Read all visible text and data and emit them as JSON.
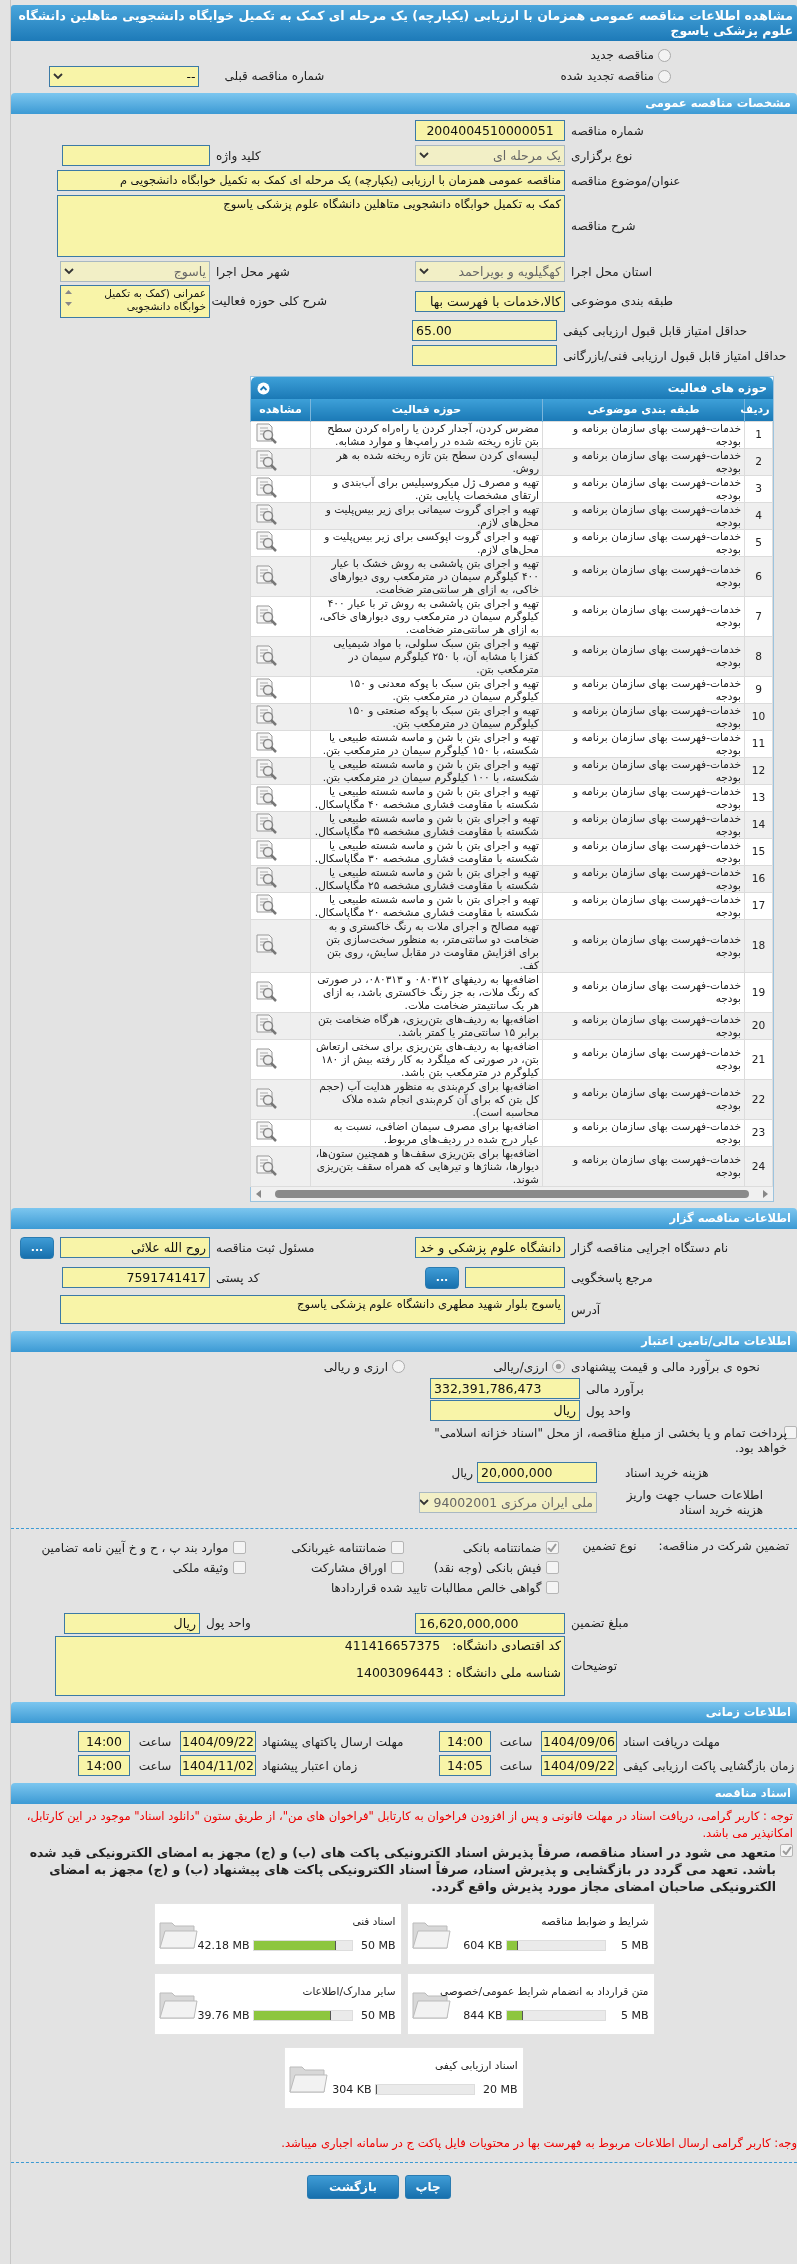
{
  "page_title": "مشاهده اطلاعات مناقصه عمومی همزمان با ارزیابی (یکپارچه) یک مرحله ای کمک به تکمیل خوابگاه دانشجویی متاهلین دانشگاه علوم پزشکی یاسوج",
  "tender_kind": [
    {
      "label": "مناقصه جدید",
      "selected": false
    },
    {
      "label": "مناقصه تجدید شده",
      "selected": false
    }
  ],
  "previous_tender": {
    "label": "شماره مناقصه قبلی",
    "value": "--"
  },
  "general": {
    "header": "مشخصات مناقصه عمومی",
    "rows": [
      [
        {
          "label": "شماره مناقصه",
          "kind": "code",
          "value": "2004004510000051"
        }
      ],
      [
        {
          "label": "نوع برگزاری",
          "kind": "select",
          "value": "یک مرحله ای"
        },
        {
          "label": "کلید واژه",
          "kind": "text"
        }
      ],
      [
        {
          "label": "عنوان/موضوع مناقصه",
          "kind": "wide",
          "value": "مناقصه عمومی همزمان با ارزیابی (یکپارچه) یک مرحله ای کمک به تکمیل خوابگاه دانشجویی م"
        }
      ],
      [
        {
          "label": "شرح مناقصه",
          "kind": "area",
          "value": "کمک به تکمیل خوابگاه دانشجویی متاهلین دانشگاه علوم پزشکی یاسوج"
        }
      ],
      [
        {
          "label": "استان محل اجرا",
          "kind": "select",
          "value": "کهگیلویه و بویراحمد"
        },
        {
          "label": "شهر محل اجرا",
          "kind": "select",
          "value": "یاسوج"
        }
      ],
      [
        {
          "label": "طبقه بندی موضوعی",
          "kind": "text",
          "value": "کالا،خدمات با فهرست بها"
        },
        {
          "label": "شرح کلی حوزه فعالیت",
          "kind": "list",
          "value": "عمرانی  (کمک به تکمیل خوابگاه دانشجویی"
        }
      ],
      [
        {
          "label": "حداقل امتیاز قابل قبول ارزیابی کیفی",
          "kind": "score",
          "value": "65.00"
        }
      ],
      [
        {
          "label": "حداقل امتیاز قابل قبول ارزیابی فنی/بازرگانی",
          "kind": "score"
        }
      ]
    ]
  },
  "activities": {
    "header": "حوزه های فعالیت",
    "columns": [
      "ردیف",
      "طبقه بندی موضوعی",
      "حوزه فعالیت",
      "مشاهده"
    ],
    "rows": [
      [
        "1",
        "خدمات-فهرست بهای سازمان برنامه و بودجه",
        "مضرس کردن، آجدار کردن یا راه‌راه کردن سطح بتن تازه ریخته شده در رامپ‌ها و موارد مشابه."
      ],
      [
        "2",
        "خدمات-فهرست بهای سازمان برنامه و بودجه",
        "لیسه‌ای کردن سطح بتن تازه ریخته شده به هر روش."
      ],
      [
        "3",
        "خدمات-فهرست بهای سازمان برنامه و بودجه",
        "تهیه و مصرف ژل میکروسیلیس برای آب‌بندی و ارتقای مشخصات پایایی بتن."
      ],
      [
        "4",
        "خدمات-فهرست بهای سازمان برنامه و بودجه",
        "تهیه و اجرای گروت سیمانی برای زیر بیس‌پلیت و محل‌های لازم."
      ],
      [
        "5",
        "خدمات-فهرست بهای سازمان برنامه و بودجه",
        "تهیه و اجرای گروت اپوکسی برای زیر بیس‌پلیت و محل‌های لازم."
      ],
      [
        "6",
        "خدمات-فهرست بهای سازمان برنامه و بودجه",
        "تهیه و اجرای بتن پاششی به روش خشک با عیار ۴۰۰ کیلوگرم سیمان در مترمکعب روی دیوارهای خاکی، به ازای هر سانتی‌متر ضخامت."
      ],
      [
        "7",
        "خدمات-فهرست بهای سازمان برنامه و بودجه",
        "تهیه و اجرای بتن پاششی به روش تر با عیار ۴۰۰ کیلوگرم سیمان در مترمکعب روی دیوارهای خاکی، به ازای هر سانتی‌متر ضخامت."
      ],
      [
        "8",
        "خدمات-فهرست بهای سازمان برنامه و بودجه",
        "تهیه و اجرای بتن سبک سلولی، با مواد شیمیایی کفزا یا مشابه آن، با ۲۵۰ کیلوگرم سیمان در مترمکعب بتن."
      ],
      [
        "9",
        "خدمات-فهرست بهای سازمان برنامه و بودجه",
        "تهیه و اجرای بتن سبک با پوکه معدنی و ۱۵۰ کیلوگرم سیمان در مترمکعب بتن."
      ],
      [
        "10",
        "خدمات-فهرست بهای سازمان برنامه و بودجه",
        "تهیه و اجرای بتن سبک با پوکه صنعتی و ۱۵۰ کیلوگرم سیمان در مترمکعب بتن."
      ],
      [
        "11",
        "خدمات-فهرست بهای سازمان برنامه و بودجه",
        "تهیه و اجرای بتن با شن و ماسه شسته طبیعی یا شکسته، با ۱۵۰ کیلوگرم سیمان در مترمکعب بتن."
      ],
      [
        "12",
        "خدمات-فهرست بهای سازمان برنامه و بودجه",
        "تهیه و اجرای بتن با شن و ماسه شسته طبیعی یا شکسته، با ۱۰۰ کیلوگرم سیمان در مترمکعب بتن."
      ],
      [
        "13",
        "خدمات-فهرست بهای سازمان برنامه و بودجه",
        "تهیه و اجرای بتن با شن و ماسه شسته طبیعی یا شکسته با مقاومت فشاری مشخصه ۴۰ مگاپاسکال."
      ],
      [
        "14",
        "خدمات-فهرست بهای سازمان برنامه و بودجه",
        "تهیه و اجرای بتن با شن و ماسه شسته طبیعی یا شکسته با مقاومت فشاری مشخصه ۳۵ مگاپاسکال."
      ],
      [
        "15",
        "خدمات-فهرست بهای سازمان برنامه و بودجه",
        "تهیه و اجرای بتن با شن و ماسه شسته طبیعی یا شکسته با مقاومت فشاری مشخصه ۳۰ مگاپاسکال."
      ],
      [
        "16",
        "خدمات-فهرست بهای سازمان برنامه و بودجه",
        "تهیه و اجرای بتن با شن و ماسه شسته طبیعی یا شکسته با مقاومت فشاری مشخصه ۲۵ مگاپاسکال."
      ],
      [
        "17",
        "خدمات-فهرست بهای سازمان برنامه و بودجه",
        "تهیه و اجرای بتن با شن و ماسه شسته طبیعی یا شکسته با مقاومت فشاری مشخصه ۲۰ مگاپاسکال."
      ],
      [
        "18",
        "خدمات-فهرست بهای سازمان برنامه و بودجه",
        "تهیه مصالح و اجرای ملات به رنگ خاکستری و به ضخامت دو سانتی‌متر، به منظور سخت‌سازی بتن برای افزایش مقاومت در مقابل سایش، روی بتن کف."
      ],
      [
        "19",
        "خدمات-فهرست بهای سازمان برنامه و بودجه",
        "اضافه‌بها به ردیفهای ۰۸۰۳۱۲ و ۰۸۰۳۱۳، در صورتی که رنگ ملات، به جز رنگ خاکستری باشد، به ازای هر یک سانتیمتر ضخامت ملات."
      ],
      [
        "20",
        "خدمات-فهرست بهای سازمان برنامه و بودجه",
        "اضافه‌بها به ردیف‌های بتن‌ریزی، هرگاه ضخامت بتن برابر ۱۵ سانتی‌متر یا کمتر باشد."
      ],
      [
        "21",
        "خدمات-فهرست بهای سازمان برنامه و بودجه",
        "اضافه‌بها به ردیف‌های بتن‌ریزی برای سختی ارتعاش بتن، در صورتی که میلگرد به کار رفته بیش از ۱۸۰ کیلوگرم در مترمکعب بتن باشد."
      ],
      [
        "22",
        "خدمات-فهرست بهای سازمان برنامه و بودجه",
        "اضافه‌بها برای کرم‌بندی به منظور هدایت آب (حجم کل بتن که برای آن کرم‌بندی انجام شده ملاک محاسبه است)."
      ],
      [
        "23",
        "خدمات-فهرست بهای سازمان برنامه و بودجه",
        "اضافه‌بها برای مصرف سیمان اضافی، نسبت به عیار درج شده در ردیف‌های مربوط."
      ],
      [
        "24",
        "خدمات-فهرست بهای سازمان برنامه و بودجه",
        "اضافه‌بها برای بتن‌ریزی سقف‌ها و همچنین ستون‌ها، دیوارها، شناژها و تیرهایی که همراه سقف بتن‌ریزی شوند."
      ]
    ]
  },
  "organizer": {
    "header": "اطلاعات مناقصه گزار",
    "rows": [
      [
        {
          "label": "نام دستگاه اجرایی مناقصه گزار",
          "kind": "text",
          "value": "دانشگاه علوم پزشکی و خد"
        },
        {
          "label": "مسئول ثبت مناقصه",
          "kind": "text",
          "value": "روح الله علائی",
          "button": "..."
        }
      ],
      [
        {
          "label": "مرجع پاسخگویی",
          "kind": "text",
          "button": "..."
        },
        {
          "label": "کد پستی",
          "kind": "text",
          "value": "7591741417"
        }
      ],
      [
        {
          "label": "آدرس",
          "kind": "area",
          "value": "یاسوج بلوار شهید مطهری دانشگاه علوم پزشکی یاسوج"
        }
      ]
    ]
  },
  "finance": {
    "header": "اطلاعات مالی/تامین اعتبار",
    "estimate_method": {
      "label": "نحوه ی برآورد مالی و قیمت پیشنهادی",
      "options": [
        {
          "label": "ارزی/ریالی",
          "selected": true
        },
        {
          "label": "ارزی و ریالی",
          "selected": false
        }
      ]
    },
    "estimate": {
      "label": "برآورد مالی",
      "value": "332,391,786,473"
    },
    "currency": {
      "label": "واحد پول",
      "value": "ریال"
    },
    "treasury": {
      "label": "پرداخت تمام و یا بخشی از مبلغ مناقصه، از محل \"اسناد خزانه اسلامی\" خواهد بود.",
      "checked": false
    },
    "doc_fee": {
      "label": "هزینه خرید اسناد",
      "value": "20,000,000",
      "unit": "ریال"
    },
    "account": {
      "label": "اطلاعات حساب جهت واریز هزینه خرید اسناد",
      "value": "ملی ایران مرکزی 94002001"
    },
    "guarantee_label": "تضمین شرکت در مناقصه:",
    "guarantee_type_label": "نوع تضمین",
    "guarantee_types": [
      {
        "label": "ضمانتنامه بانکی",
        "checked": true
      },
      {
        "label": "ضمانتنامه غیربانکی",
        "checked": false
      },
      {
        "label": "موارد بند پ ، ح و خ آیین نامه تضامین",
        "checked": false
      },
      {
        "label": "فیش بانکی (وجه نقد)",
        "checked": false
      },
      {
        "label": "اوراق مشارکت",
        "checked": false
      },
      {
        "label": "وثیقه ملکی",
        "checked": false
      },
      {
        "label": "گواهی خالص مطالبات تایید شده قراردادها",
        "checked": false
      }
    ],
    "guarantee_amount": {
      "label": "مبلغ تضمین",
      "value": "16,620,000,000"
    },
    "guarantee_currency": {
      "label": "واحد پول",
      "value": "ریال"
    },
    "notes": {
      "label": "توضیحات",
      "lines": [
        "کد اقتصادی دانشگاه:   411416657375",
        "شناسه ملی دانشگاه : 14003096443"
      ]
    }
  },
  "schedule": {
    "header": "اطلاعات زمانی",
    "items": [
      {
        "label": "مهلت دریافت اسناد",
        "date": "1404/09/06",
        "time_label": "ساعت",
        "time": "14:00"
      },
      {
        "label": "مهلت ارسال پاکتهای پیشنهاد",
        "date": "1404/09/22",
        "time_label": "ساعت",
        "time": "14:00"
      },
      {
        "label": "زمان بازگشایی پاکت ارزیابی کیفی",
        "date": "1404/09/22",
        "time_label": "ساعت",
        "time": "14:05"
      },
      {
        "label": "زمان اعتبار پیشنهاد",
        "date": "1404/11/02",
        "time_label": "ساعت",
        "time": "14:00"
      }
    ]
  },
  "documents": {
    "header": "اسناد مناقصه",
    "notice": "توجه : کاربر گرامی، دریافت اسناد در مهلت قانونی و پس از افزودن فراخوان به کارتابل \"فراخوان های من\"، از طریق ستون \"دانلود اسناد\" موجود در این کارتابل، امکانپذیر می باشد.",
    "commitment": {
      "text": "متعهد می شود در اسناد مناقصه، صرفاً پذیرش اسناد الکترونیکی پاکت های (ب) و (ج) مجهز به امضای الکترونیکی قید شده باشد. تعهد می گردد در بازگشایی و پذیرش اسناد، صرفاً اسناد الکترونیکی پاکت های پیشنهاد (ب) و (ج) مجهز به امضای الکترونیکی صاحبان امضای مجاز مورد پذیرش واقع گردد.",
      "checked": true
    },
    "files": [
      {
        "title": "شرایط و ضوابط مناقصه",
        "size": "604 KB",
        "limit": "5 MB",
        "level": 0.12
      },
      {
        "title": "اسناد فنی",
        "size": "42.18 MB",
        "limit": "50 MB",
        "level": 0.84
      },
      {
        "title": "متن قرارداد به انضمام شرایط عمومی/خصوصی",
        "size": "844 KB",
        "limit": "5 MB",
        "level": 0.165
      },
      {
        "title": "سایر مدارک/اطلاعات",
        "size": "39.76 MB",
        "limit": "50 MB",
        "level": 0.795
      },
      {
        "title": "اسناد ارزیابی کیفی",
        "size": "304 KB",
        "limit": "20 MB",
        "level": 0.015
      }
    ],
    "footer_note": "وجه: کاربر گرامی ارسال اطلاعات مربوط به فهرست بها در محتویات فایل پاکت ج در سامانه اجباری میباشد."
  },
  "buttons": [
    "چاپ",
    "بازگشت"
  ]
}
